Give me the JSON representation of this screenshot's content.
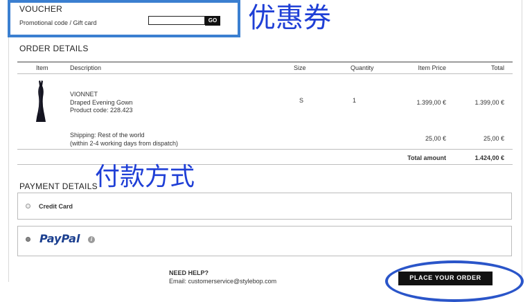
{
  "voucher": {
    "title": "VOUCHER",
    "label": "Promotional code / Gift card",
    "input_value": "",
    "go_label": "GO",
    "annotation": "优惠券"
  },
  "order": {
    "title": "ORDER DETAILS",
    "headers": {
      "item": "Item",
      "description": "Description",
      "size": "Size",
      "quantity": "Quantity",
      "item_price": "Item Price",
      "total": "Total"
    },
    "product": {
      "brand": "VIONNET",
      "name": "Draped Evening Gown",
      "code": "Product code: 228.423",
      "size": "S",
      "quantity": "1",
      "item_price": "1.399,00 €",
      "total": "1.399,00 €"
    },
    "shipping": {
      "line1": "Shipping: Rest of the world",
      "line2": "(within 2-4 working days from dispatch)",
      "item_price": "25,00 €",
      "total": "25,00 €"
    },
    "total_label": "Total amount",
    "total_value": "1.424,00 €"
  },
  "payment": {
    "title": "PAYMENT DETAILS",
    "annotation": "付款方式",
    "credit_card_label": "Credit Card",
    "paypal_label": "PayPal",
    "info_glyph": "i"
  },
  "help": {
    "title": "NEED HELP?",
    "email_line": "Email: customerservice@stylebop.com"
  },
  "place_order_label": "PLACE YOUR ORDER",
  "colors": {
    "annotation_blue": "#1f3fd6",
    "highlight_box": "#3b7fd0",
    "paypal_blue": "#1b3f8f"
  }
}
